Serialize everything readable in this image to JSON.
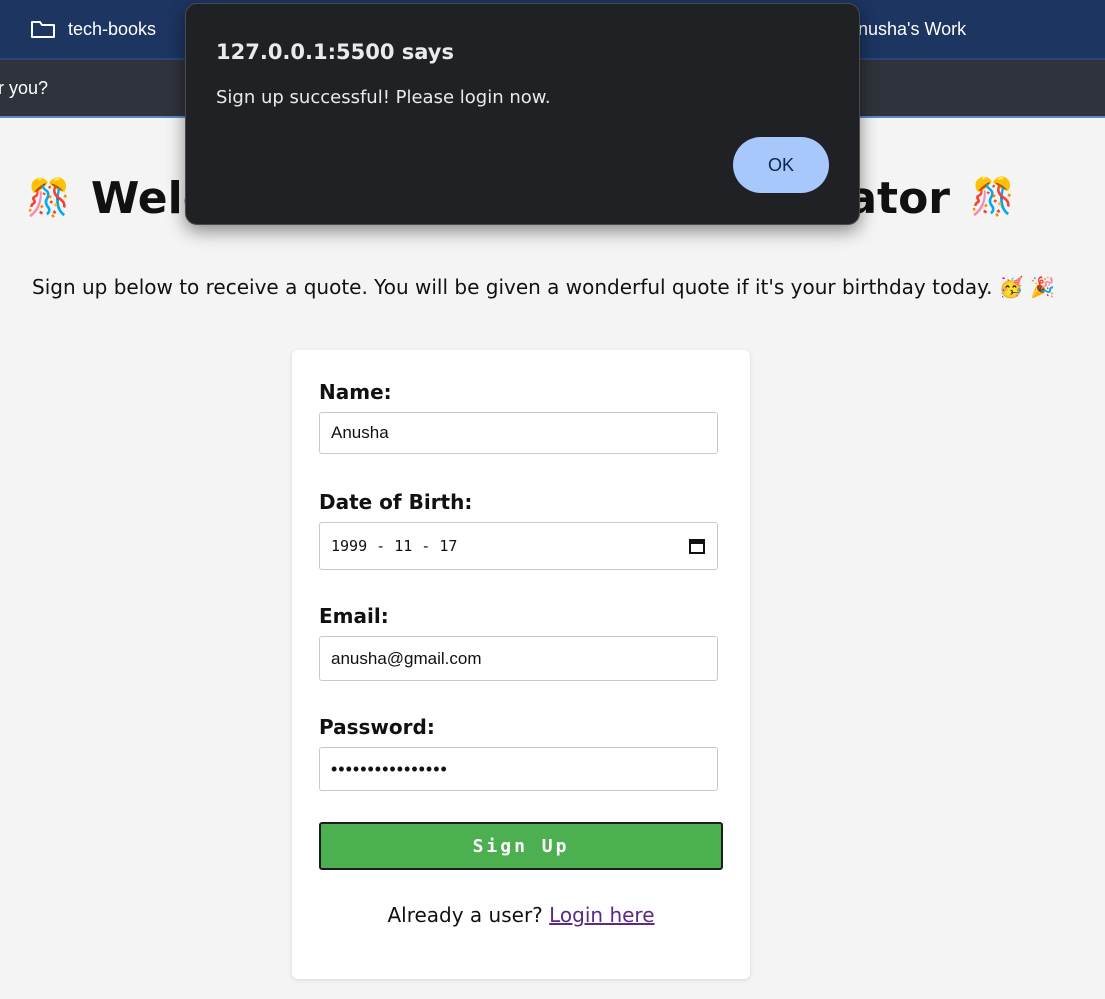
{
  "bookmarks": {
    "folder_label": "tech-books",
    "right_label": "Anusha's Work"
  },
  "subbar": {
    "text": "r you?"
  },
  "page": {
    "heading_left": "Welc",
    "heading_right": "rator",
    "heading_emoji": "🎊",
    "intro": "Sign up below to receive a quote. You will be given a wonderful quote if it's your birthday today. 🥳 🎉"
  },
  "form": {
    "name_label": "Name:",
    "name_value": "Anusha",
    "dob_label": "Date of Birth:",
    "dob_value": "1999 - 11 - 17",
    "email_label": "Email:",
    "email_value": "anusha@gmail.com",
    "password_label": "Password:",
    "password_value": "••••••••••••••••",
    "submit_label": "Sign Up",
    "login_prompt": "Already a user?",
    "login_link": "Login here"
  },
  "dialog": {
    "title": "127.0.0.1:5500 says",
    "message": "Sign up successful! Please login now.",
    "ok_label": "OK"
  },
  "colors": {
    "bookmarks_bg": "#1c3561",
    "submit_bg": "#4caf50",
    "dialog_bg": "#202124",
    "ok_bg": "#a8c7fa"
  }
}
